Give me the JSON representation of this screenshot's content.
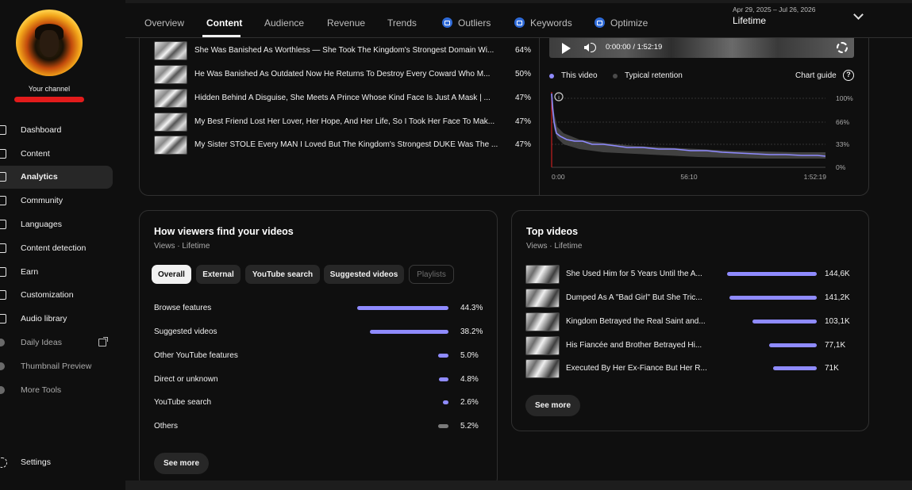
{
  "sidebar": {
    "channel_label": "Your channel",
    "items": [
      {
        "label": "Dashboard",
        "icon": "dashboard-icon"
      },
      {
        "label": "Content",
        "icon": "content-icon"
      },
      {
        "label": "Analytics",
        "icon": "analytics-icon",
        "active": true
      },
      {
        "label": "Community",
        "icon": "community-icon"
      },
      {
        "label": "Languages",
        "icon": "languages-icon"
      },
      {
        "label": "Content detection",
        "icon": "content-detection-icon"
      },
      {
        "label": "Earn",
        "icon": "earn-icon"
      },
      {
        "label": "Customization",
        "icon": "customization-icon"
      },
      {
        "label": "Audio library",
        "icon": "audio-library-icon"
      },
      {
        "label": "Daily Ideas",
        "icon": "extension-icon"
      },
      {
        "label": "Thumbnail Preview",
        "icon": "extension-icon"
      },
      {
        "label": "More Tools",
        "icon": "extension-icon"
      }
    ],
    "settings_label": "Settings"
  },
  "tabs": {
    "overview": "Overview",
    "content": "Content",
    "audience": "Audience",
    "revenue": "Revenue",
    "trends": "Trends",
    "outliers": "Outliers",
    "keywords": "Keywords",
    "optimize": "Optimize"
  },
  "date": {
    "range": "Apr 29, 2025 – Jul 26, 2026",
    "title": "Lifetime"
  },
  "top_content": [
    {
      "title": "She Was Banished As Worthless — She Took The Kingdom's Strongest Domain Wi...",
      "pct": "64%"
    },
    {
      "title": "He Was Banished As Outdated Now He Returns To Destroy Every Coward Who M...",
      "pct": "50%"
    },
    {
      "title": "Hidden Behind A Disguise, She Meets A Prince Whose Kind Face Is Just A Mask | ...",
      "pct": "47%"
    },
    {
      "title": "My Best Friend Lost Her Lover, Her Hope, And Her Life, So I Took Her Face To Mak...",
      "pct": "47%"
    },
    {
      "title": "My Sister STOLE Every MAN I Loved But The Kingdom's Strongest DUKE Was The ...",
      "pct": "47%"
    }
  ],
  "player": {
    "time": "0:00:00 / 1:52:19"
  },
  "retention": {
    "legend_this": "This video",
    "legend_typical": "Typical retention",
    "chart_guide": "Chart guide",
    "y_ticks": [
      "100%",
      "66%",
      "33%",
      "0%"
    ],
    "x_ticks": [
      "0:00",
      "56:10",
      "1:52:19"
    ],
    "colors": {
      "this": "#8f8bff",
      "typical": "#5a5a5a"
    }
  },
  "traffic": {
    "title": "How viewers find your videos",
    "subtitle": "Views · Lifetime",
    "chips": [
      "Overall",
      "External",
      "YouTube search",
      "Suggested videos",
      "Playlists"
    ],
    "rows": [
      {
        "label": "Browse features",
        "pct": "44.3%",
        "value": 44.3
      },
      {
        "label": "Suggested videos",
        "pct": "38.2%",
        "value": 38.2
      },
      {
        "label": "Other YouTube features",
        "pct": "5.0%",
        "value": 5.0
      },
      {
        "label": "Direct or unknown",
        "pct": "4.8%",
        "value": 4.8
      },
      {
        "label": "YouTube search",
        "pct": "2.6%",
        "value": 2.6
      },
      {
        "label": "Others",
        "pct": "5.2%",
        "value": 5.2
      }
    ],
    "see_more": "See more"
  },
  "top_videos": {
    "title": "Top videos",
    "subtitle": "Views · Lifetime",
    "rows": [
      {
        "title": "She Used Him for 5 Years Until the A...",
        "views": "144,6K",
        "value": 144.6
      },
      {
        "title": "Dumped As A \"Bad Girl\" But She Tric...",
        "views": "141,2K",
        "value": 141.2
      },
      {
        "title": "Kingdom Betrayed the Real Saint and...",
        "views": "103,1K",
        "value": 103.1
      },
      {
        "title": "His Fiancée and Brother Betrayed Hi...",
        "views": "77,1K",
        "value": 77.1
      },
      {
        "title": "Executed By Her Ex-Fiance But Her R...",
        "views": "71K",
        "value": 71
      }
    ],
    "see_more": "See more"
  }
}
